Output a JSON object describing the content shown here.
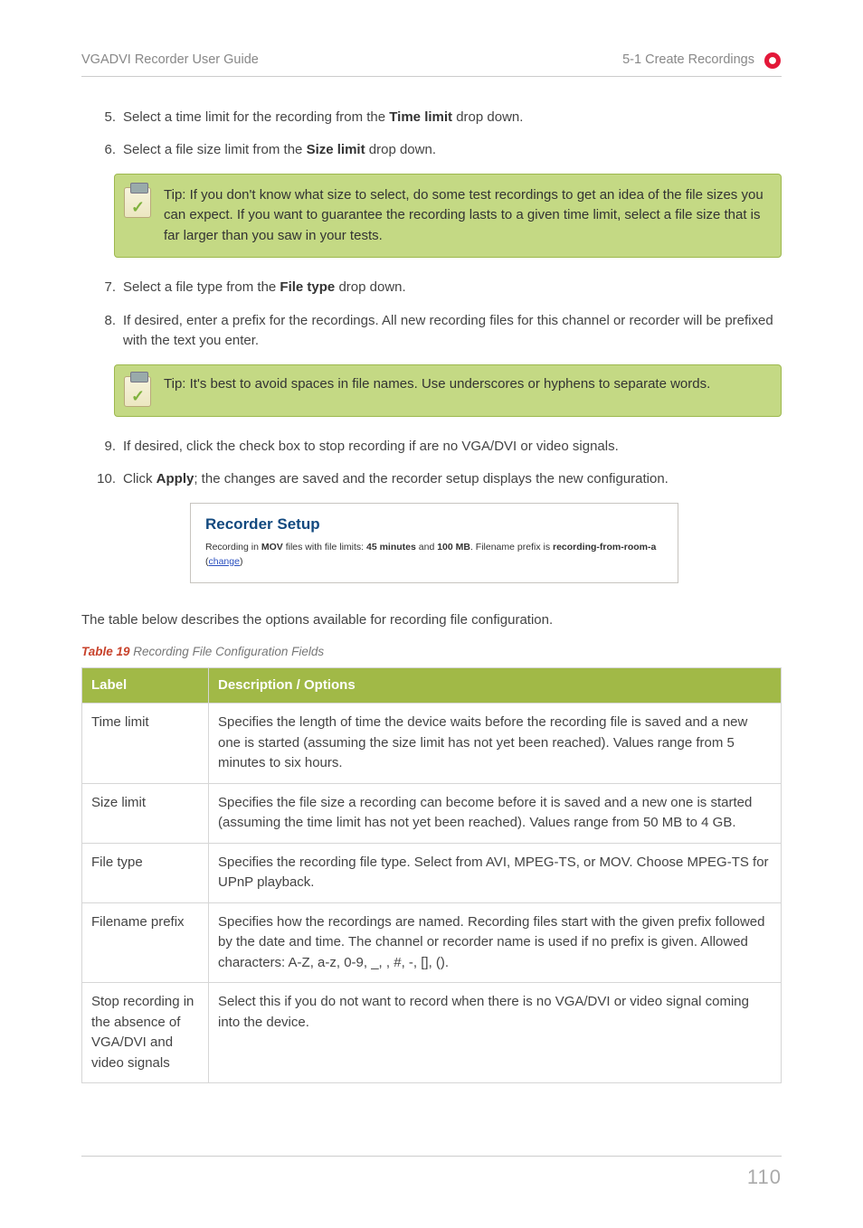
{
  "header": {
    "left": "VGADVI Recorder User Guide",
    "right": "5-1 Create Recordings"
  },
  "steps": [
    {
      "n": "5.",
      "html": "Select a time limit for the recording from the <b>Time limit</b> drop down."
    },
    {
      "n": "6.",
      "html": "Select a file size limit from the <b>Size limit</b> drop down."
    }
  ],
  "tip1": "Tip: If you don't know what size to select, do some test recordings to get an idea of the file sizes you can expect. If you want to guarantee the recording lasts to a given time limit, select a file size that is far larger than you saw in your tests.",
  "steps2": [
    {
      "n": "7.",
      "html": "Select a file type from the <b>File type</b> drop down."
    },
    {
      "n": "8.",
      "html": "If desired, enter a prefix for the recordings. All new recording files for this channel or recorder will be prefixed with the text you enter."
    }
  ],
  "tip2": "Tip: It's best to avoid spaces in file names. Use underscores or hyphens to separate words.",
  "steps3": [
    {
      "n": "9.",
      "html": "If desired, click the check box to stop recording if are no VGA/DVI or video signals."
    },
    {
      "n": "10.",
      "html": "Click <b>Apply</b>; the changes are saved and the recorder setup displays the new configuration."
    }
  ],
  "screenshot": {
    "title": "Recorder Setup",
    "line_pre": "Recording in ",
    "fmt": "MOV",
    "line_mid1": " files with file limits: ",
    "dur": "45 minutes",
    "and": " and ",
    "size": "100 MB",
    "line_mid2": ". Filename prefix is ",
    "prefix": "recording-from-room-a",
    "open": "  (",
    "change": "change",
    "close": ")"
  },
  "intro": "The table below describes the options available for recording file configuration.",
  "table_caption_bold": "Table 19",
  "table_caption_rest": " Recording File Configuration Fields",
  "table": {
    "head": {
      "c1": "Label",
      "c2": "Description / Options"
    },
    "rows": [
      {
        "label": "Time limit",
        "desc": "Specifies the length of time the device waits before the recording file is saved and a new one is started (assuming the size limit has not yet been reached). Values range from 5 minutes to six hours."
      },
      {
        "label": "Size limit",
        "desc": "Specifies the file size a recording can become before it is saved and a new one is started (assuming the time limit has not yet been reached). Values range from 50 MB to 4 GB."
      },
      {
        "label": "File type",
        "desc": "Specifies the recording file type. Select from AVI, MPEG-TS, or MOV. Choose MPEG-TS for UPnP playback."
      },
      {
        "label": "Filename prefix",
        "desc": "Specifies how the recordings are named. Recording files start with the given prefix followed by the date and time. The channel or recorder name is used if no prefix is given. Allowed characters: A-Z, a-z, 0-9, _, , #, -, [], ()."
      },
      {
        "label": "Stop recording in the absence of VGA/DVI and video signals",
        "desc": "Select this if you do not want to record when there is no VGA/DVI or video signal coming into the device."
      }
    ]
  },
  "page_number": "110"
}
